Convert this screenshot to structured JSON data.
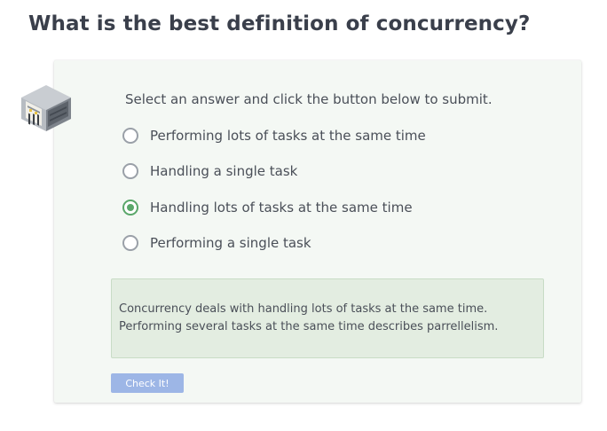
{
  "question": {
    "title": "What is the best definition of concurrency?"
  },
  "quiz": {
    "icon": "assembly-line-icon",
    "instructions": "Select an answer and click the button below to submit.",
    "options": [
      {
        "label": "Performing lots of tasks at the same time",
        "selected": false
      },
      {
        "label": "Handling a single task",
        "selected": false
      },
      {
        "label": "Handling lots of tasks at the same time",
        "selected": true
      },
      {
        "label": "Performing a single task",
        "selected": false
      }
    ],
    "feedback": {
      "line1": "Concurrency deals with handling lots of tasks at the same time.",
      "line2": "Performing several tasks at the same time describes parrellelism."
    },
    "submit_label": "Check It!"
  },
  "colors": {
    "selected_radio": "#5aa76a",
    "button": "#9db6e6",
    "feedback_bg": "#e3ede1",
    "card_bg": "#f4f8f4"
  }
}
